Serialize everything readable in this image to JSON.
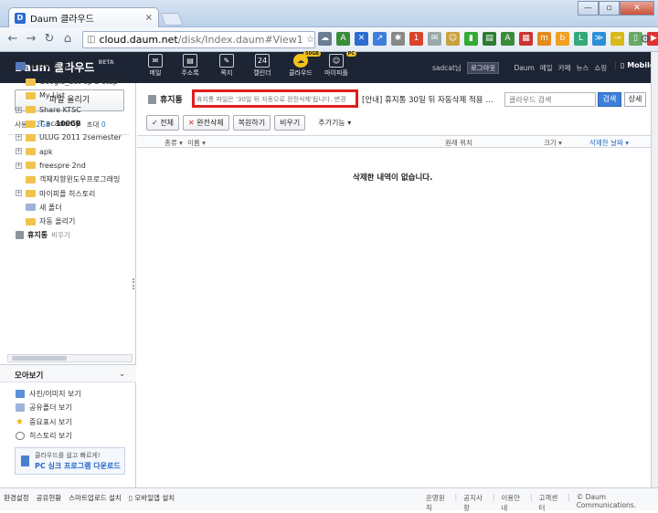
{
  "browser": {
    "tab_title": "Daum 클라우드",
    "tab_close": "×",
    "url_host": "cloud.daum.net",
    "url_path": "/disk/Index.daum#View1",
    "win_min": "—",
    "win_max": "▫",
    "win_close": "✕"
  },
  "header": {
    "logo": "Daum 클라우드",
    "beta": "BETA",
    "nav": [
      {
        "label": "메일"
      },
      {
        "label": "주소록"
      },
      {
        "label": "쪽지"
      },
      {
        "label": "캘린더",
        "icon_text": "24"
      },
      {
        "label": "클라우드",
        "badge": "50GB"
      },
      {
        "label": "마이피플",
        "badge": "PC"
      }
    ],
    "user": "sadcat님",
    "logout": "로그아웃",
    "links": [
      "Daum",
      "메일",
      "카페",
      "뉴스",
      "쇼핑"
    ],
    "mobile": "Mobile"
  },
  "sidebar": {
    "upload": "파일 올리기",
    "usage_label": "사용",
    "usage_used": "7.2GB",
    "usage_total": "100GB",
    "usage_exceed_label": "초대",
    "usage_exceed": "0",
    "home": "클라우드 홈",
    "folders": [
      {
        "name": "Google_Set up 2-step",
        "expandable": false
      },
      {
        "name": "My List",
        "expandable": false
      },
      {
        "name": "Share KTSC",
        "expandable": true
      },
      {
        "name": "T academy",
        "expandable": false
      },
      {
        "name": "ULUG 2011 2semester",
        "expandable": true
      },
      {
        "name": "apk",
        "expandable": true
      },
      {
        "name": "freespre 2nd",
        "expandable": true
      },
      {
        "name": "객체지향윈도우프로그래밍",
        "expandable": false
      },
      {
        "name": "마이피플 히스토리",
        "expandable": true
      },
      {
        "name": "새 폴더",
        "expandable": false
      },
      {
        "name": "자동 올리기",
        "expandable": false
      }
    ],
    "trash": "휴지통",
    "trash_empty": "비우기",
    "moa_title": "모아보기",
    "moa_items": [
      "사진/이미지 보기",
      "공유폴더 보기",
      "중요표시 보기",
      "히스토리 보기"
    ],
    "sync_small": "클라우드를 쉽고 빠르게!",
    "sync_big": "PC 싱크 프로그램 다운로드"
  },
  "main": {
    "title": "휴지통",
    "notice": "휴지통 파일은 '30일 뒤 자동으로 완전삭제'됩니다. 변경",
    "announce": "[안내] 휴지통 30일 뒤 자동삭제 적용 ...",
    "search_placeholder": "클라우드 검색",
    "search_btn": "검색",
    "adv_btn": "상세",
    "actions": {
      "all": "✓ 전체",
      "delete": "완전삭제",
      "restore": "복원하기",
      "empty": "비우기",
      "more": "추가기능 ▾"
    },
    "columns": {
      "type": "종류 ▾",
      "name": "이름 ▾",
      "location": "원래 위치",
      "size": "크기 ▾",
      "deleted": "삭제한 날짜 ▾"
    },
    "empty_message": "삭제한 내역이 없습니다."
  },
  "footer": {
    "left": [
      "환경설정",
      "공유현황",
      "스마트업로드 설치",
      "모바일앱 설치"
    ],
    "right": [
      "운영원칙",
      "공지사항",
      "이용안내",
      "고객센터",
      "© Daum Communications."
    ]
  }
}
